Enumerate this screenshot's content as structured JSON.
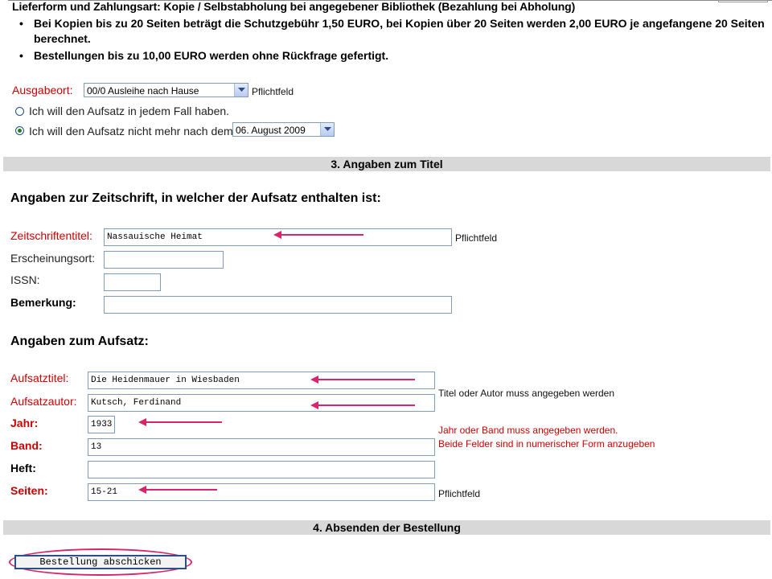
{
  "intro": {
    "title": "Lieferform und Zahlungsart: Kopie / Selbstabholung bei angegebener Bibliothek (Bezahlung bei Abholung)",
    "bullets": [
      "Bei Kopien bis zu 20 Seiten beträgt die Schutzgebühr 1,50 EURO, bei Kopien über 20 Seiten werden 2,00 EURO je angefangene 20 Seiten",
      "berechnet.",
      "Bestellungen bis zu 10,00 EURO werden ohne Rückfrage gefertigt."
    ]
  },
  "ausgabeort": {
    "label": "Ausgabeort:",
    "value": "00/0 Ausleihe nach Hause",
    "hint": "Pflichtfeld"
  },
  "radios": {
    "option1": "Ich will den Aufsatz in jedem Fall haben.",
    "option2": "Ich will den Aufsatz nicht mehr nach dem",
    "date_value": "06. August 2009",
    "selected": "option2"
  },
  "section3": {
    "title": "3. Angaben zum Titel"
  },
  "zeitschrift": {
    "heading": "Angaben zur Zeitschrift, in welcher der Aufsatz enthalten ist:",
    "titel_label": "Zeitschriftentitel:",
    "titel_value": "Nassauische Heimat",
    "titel_hint": "Pflichtfeld",
    "ort_label": "Erscheinungsort:",
    "ort_value": "",
    "issn_label": "ISSN:",
    "issn_value": "",
    "bemerkung_label": "Bemerkung:",
    "bemerkung_value": ""
  },
  "aufsatz": {
    "heading": "Angaben zum Aufsatz:",
    "titel_label": "Aufsatztitel:",
    "titel_value": "Die Heidenmauer in Wiesbaden",
    "autor_label": "Aufsatzautor:",
    "autor_value": "Kutsch, Ferdinand",
    "titel_autor_hint": "Titel oder Autor muss angegeben werden",
    "jahr_label": "Jahr:",
    "jahr_value": "1933",
    "band_label": "Band:",
    "band_value": "13",
    "jahr_band_hint_1": "Jahr oder Band muss angegeben werden.",
    "jahr_band_hint_2": "Beide Felder sind in numerischer Form anzugeben",
    "heft_label": "Heft:",
    "heft_value": "",
    "seiten_label": "Seiten:",
    "seiten_value": "15-21",
    "seiten_hint": "Pflichtfeld"
  },
  "section4": {
    "title": "4. Absenden der Bestellung"
  },
  "submit": {
    "label": "Bestellung abschicken"
  },
  "colors": {
    "required_label": "#cc0000",
    "annotation_arrow": "#d6256b",
    "section_bar": "#d8d8d8"
  }
}
